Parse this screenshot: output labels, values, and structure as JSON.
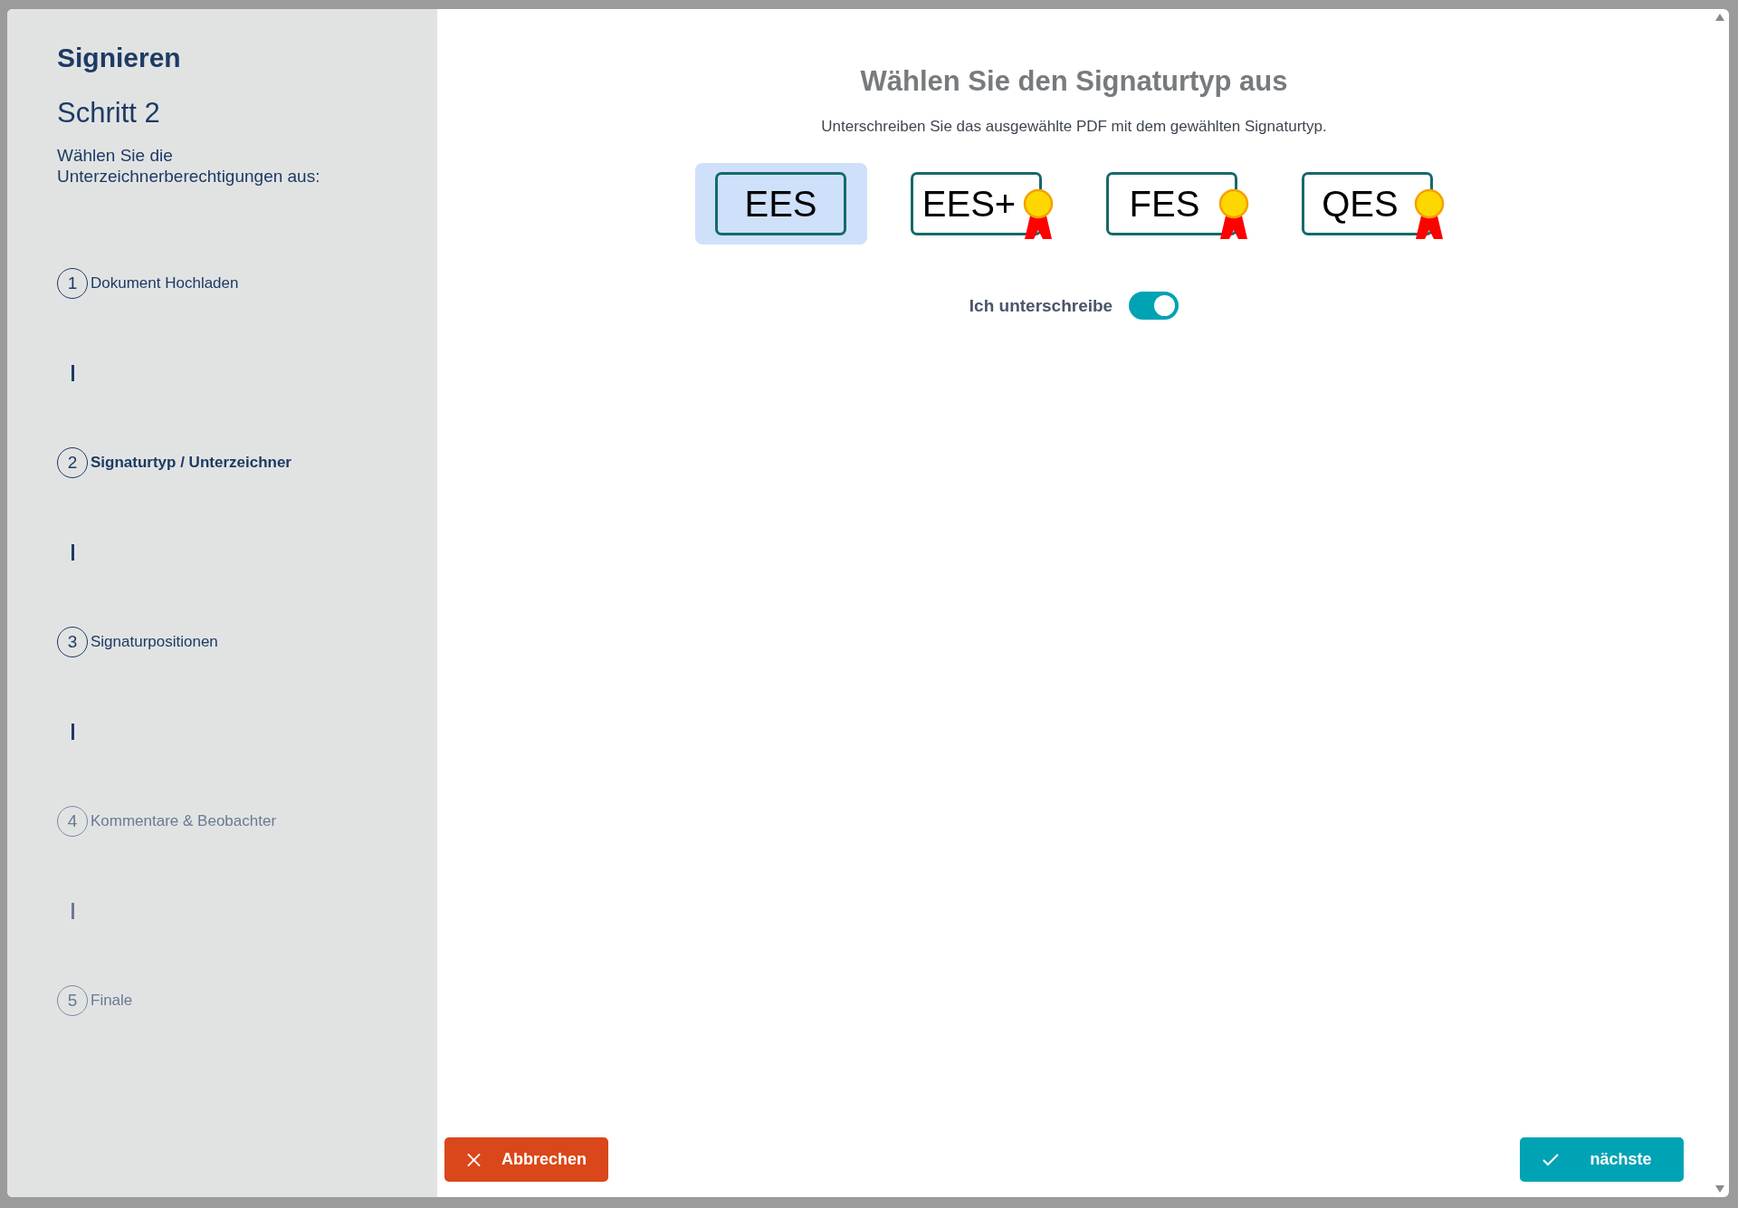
{
  "sidebar": {
    "title": "Signieren",
    "step_heading": "Schritt 2",
    "instruction": "Wählen Sie die Unterzeichnerberechtigungen aus:",
    "steps": [
      {
        "number": "1",
        "label": "Dokument Hochladen",
        "selected": false,
        "disabled": false
      },
      {
        "number": "2",
        "label": "Signaturtyp / Unterzeichner",
        "selected": true,
        "disabled": false
      },
      {
        "number": "3",
        "label": "Signaturpositionen",
        "selected": false,
        "disabled": false
      },
      {
        "number": "4",
        "label": "Kommentare & Beobachter",
        "selected": false,
        "disabled": true
      },
      {
        "number": "5",
        "label": "Finale",
        "selected": false,
        "disabled": true
      }
    ]
  },
  "main": {
    "title": "Wählen Sie den Signaturtyp aus",
    "subtitle": "Unterschreiben Sie das ausgewählte PDF mit dem gewählten Signaturtyp.",
    "signature_types": [
      {
        "label": "EES",
        "kind": "plain",
        "selected": true
      },
      {
        "label": "EES+",
        "kind": "sealed",
        "selected": false
      },
      {
        "label": "FES",
        "kind": "sealed",
        "selected": false
      },
      {
        "label": "QES",
        "kind": "sealed",
        "selected": false
      }
    ],
    "self_sign": {
      "label": "Ich unterschreibe",
      "on": true
    }
  },
  "buttons": [
    {
      "label": "Abbrechen",
      "kind": "cancel"
    },
    {
      "label": "nächste",
      "kind": "next"
    }
  ]
}
